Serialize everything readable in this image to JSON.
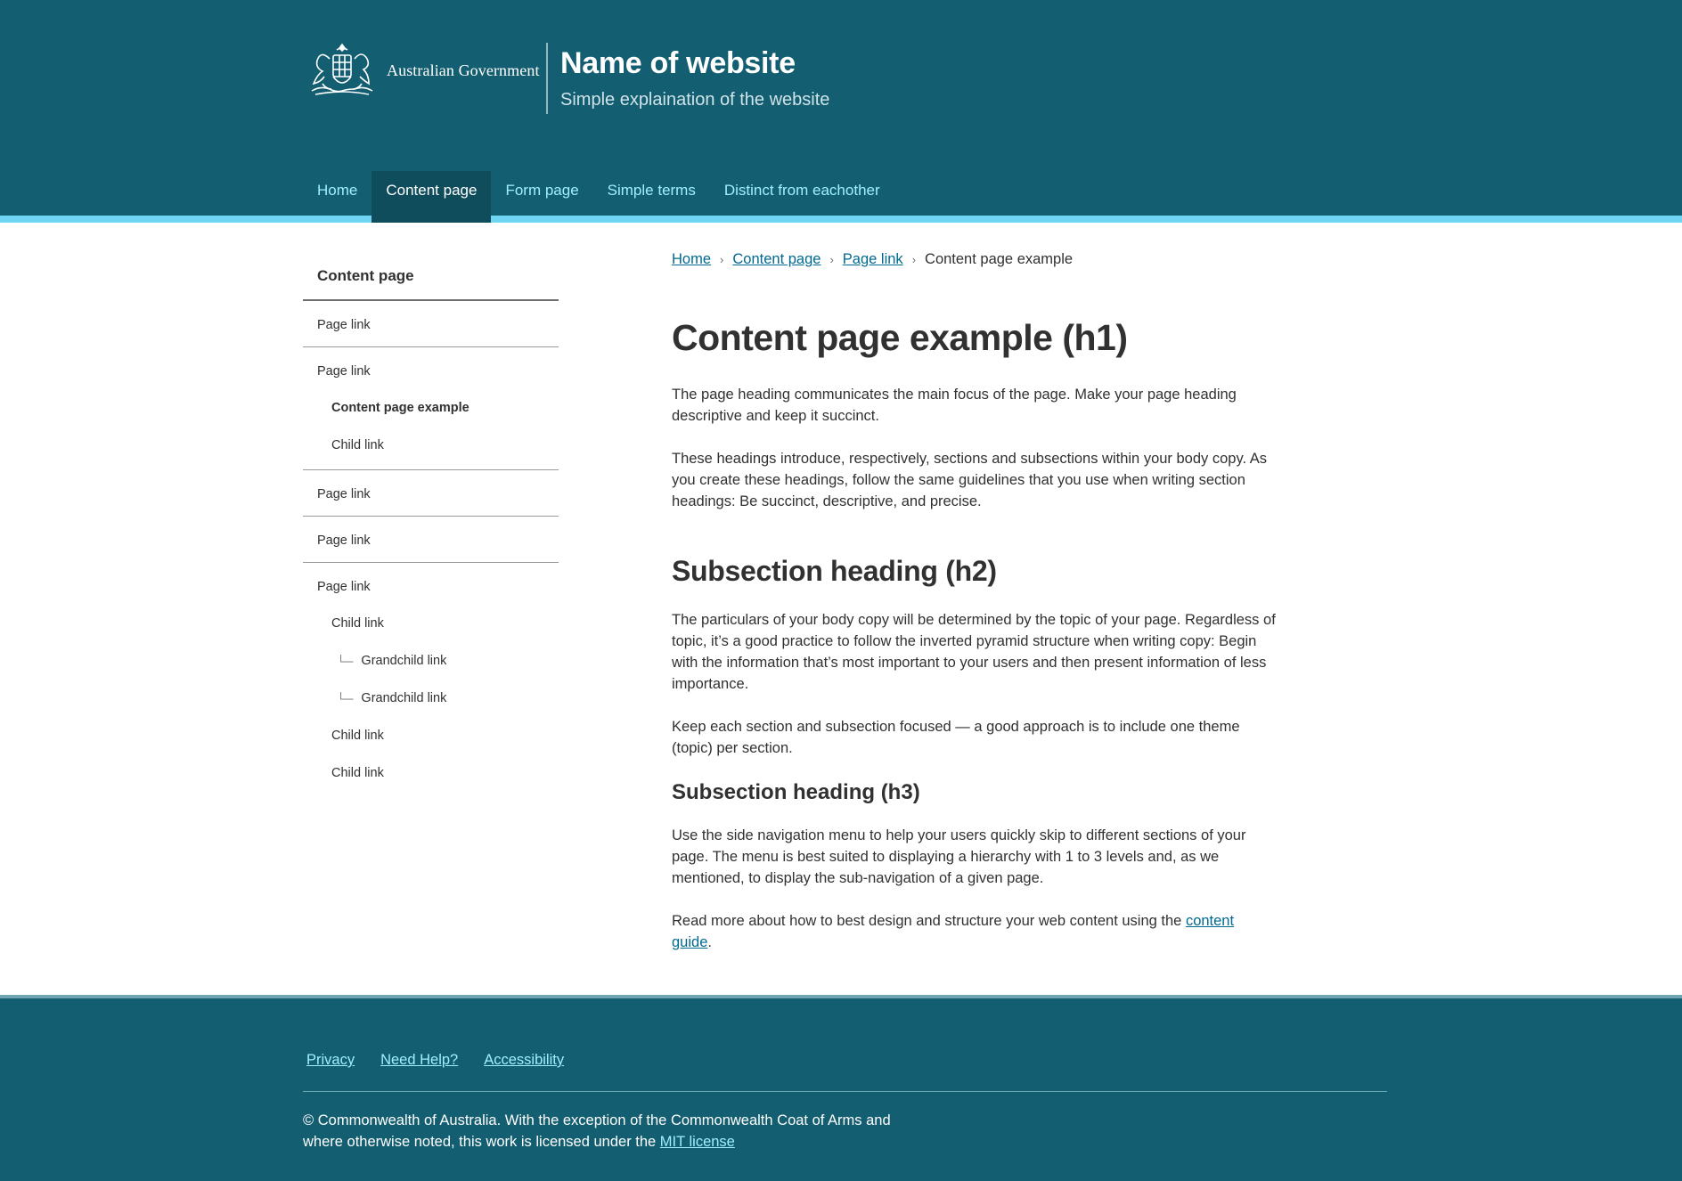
{
  "header": {
    "government_name": "Australian Government",
    "site_title": "Name of website",
    "site_tagline": "Simple explaination of the website"
  },
  "main_nav": {
    "items": [
      {
        "label": "Home"
      },
      {
        "label": "Content page"
      },
      {
        "label": "Form page"
      },
      {
        "label": "Simple terms"
      },
      {
        "label": "Distinct from eachother"
      }
    ],
    "active": "Content page"
  },
  "sidenav": {
    "heading": "Content page",
    "items": {
      "page1": "Page link",
      "page2": "Page link",
      "page2_child_current": "Content page example",
      "page2_child2": "Child link",
      "page3": "Page link",
      "page4": "Page link",
      "page5": "Page link",
      "page5_child1": "Child link",
      "page5_grandchild1": "Grandchild link",
      "page5_grandchild2": "Grandchild link",
      "page5_child2": "Child link",
      "page5_child3": "Child link"
    }
  },
  "breadcrumb": {
    "items": [
      "Home",
      "Content page",
      "Page link"
    ],
    "current": "Content page example"
  },
  "article": {
    "h1": "Content page example (h1)",
    "p1": "The page heading communicates the main focus of the page. Make your page heading descriptive and keep it succinct.",
    "p2": "These headings introduce, respectively, sections and subsections within your body copy. As you create these headings, follow the same guidelines that you use when writing section headings: Be succinct, descriptive, and precise.",
    "h2": "Subsection heading (h2)",
    "p3": "The particulars of your body copy will be determined by the topic of your page. Regardless of topic, it’s a good practice to follow the inverted pyramid structure when writing copy: Begin with the information that’s most important to your users and then present information of less importance.",
    "p4": "Keep each section and subsection focused — a good approach is to include one theme (topic) per section.",
    "h3": "Subsection heading (h3)",
    "p5": "Use the side navigation menu to help your users quickly skip to different sections of your page. The menu is best suited to displaying a hierarchy with 1 to 3 levels and, as we mentioned, to display the sub-navigation of a given page.",
    "p6_text": "Read more about how to best design and structure your web content using the ",
    "p6_link": "content guide",
    "p6_end": "."
  },
  "footer": {
    "links": [
      "Privacy",
      "Need Help?",
      "Accessibility"
    ],
    "copyright": "© Commonwealth of Australia. With the exception of the Commonwealth Coat of Arms and where otherwise noted, this work is licensed under the ",
    "license_link": "MIT license"
  },
  "colors": {
    "masthead": "#135e70",
    "nav_active": "#104d5c",
    "nav_stripe": "#6ed5f2",
    "nav_link": "#9ef0ff",
    "body_link": "#00698f",
    "text": "#313131"
  }
}
